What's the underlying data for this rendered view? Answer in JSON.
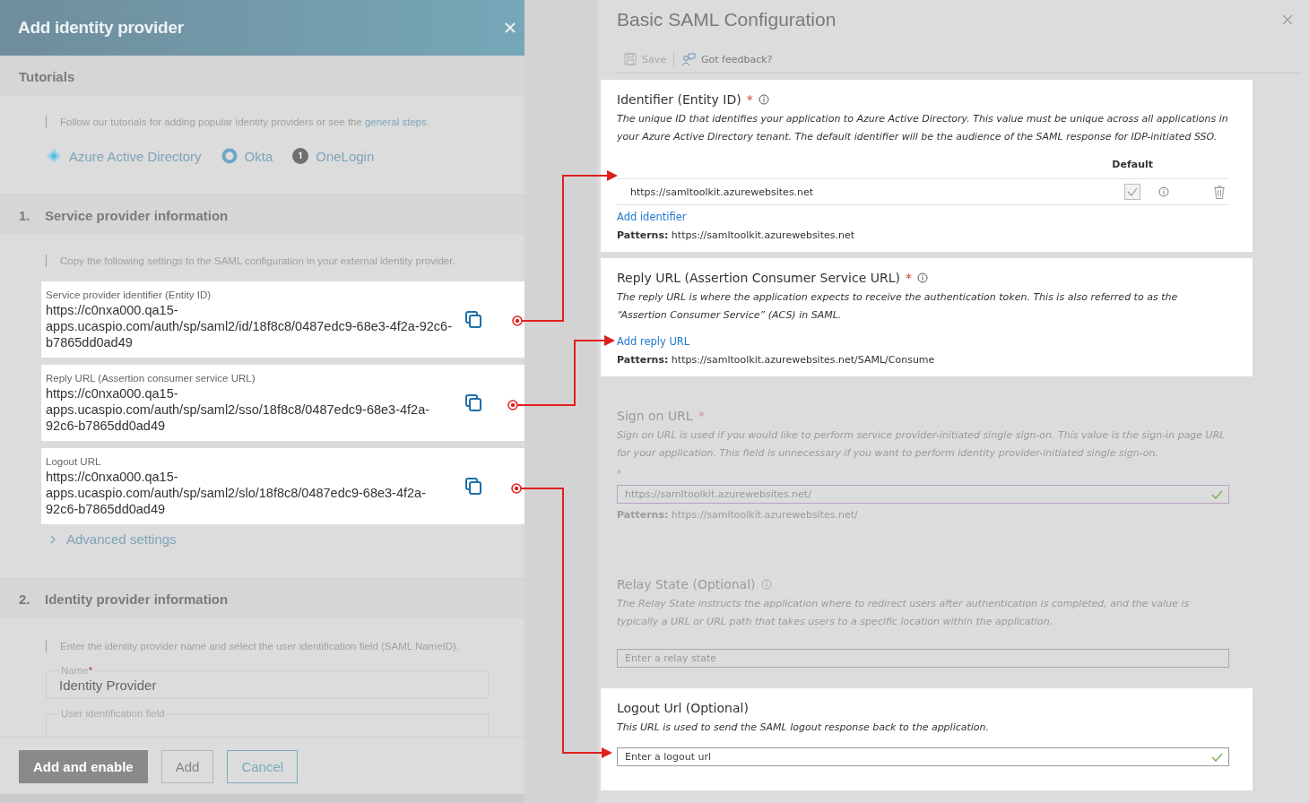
{
  "left_panel": {
    "title": "Add identity provider",
    "tutorials": {
      "heading": "Tutorials",
      "intro": "Follow our tutorials for adding popular identity providers or see the",
      "intro_link": "general steps",
      "intro_end": ".",
      "links": [
        {
          "label": "Azure Active Directory",
          "kind": "azure"
        },
        {
          "label": "Okta",
          "kind": "okta"
        },
        {
          "label": "OneLogin",
          "kind": "onelogin"
        }
      ]
    },
    "sections": [
      {
        "number": "1.",
        "title": "Service provider information",
        "description": "Copy the following settings to the SAML configuration in your external identity provider.",
        "fields": [
          {
            "label": "Service provider identifier (Entity ID)",
            "value": "https://c0nxa000.qa15-apps.ucaspio.com/auth/sp/saml2/id/18f8c8/0487edc9-68e3-4f2a-92c6-b7865dd0ad49"
          },
          {
            "label": "Reply URL (Assertion consumer service URL)",
            "value": "https://c0nxa000.qa15-apps.ucaspio.com/auth/sp/saml2/sso/18f8c8/0487edc9-68e3-4f2a-92c6-b7865dd0ad49"
          },
          {
            "label": "Logout URL",
            "value": "https://c0nxa000.qa15-apps.ucaspio.com/auth/sp/saml2/slo/18f8c8/0487edc9-68e3-4f2a-92c6-b7865dd0ad49"
          }
        ],
        "advanced": "Advanced settings"
      },
      {
        "number": "2.",
        "title": "Identity provider information",
        "description": "Enter the identity provider name and select the user identification field (SAML NameID).",
        "inputs": [
          {
            "label": "Name",
            "required_mark": "*",
            "value": "Identity Provider"
          },
          {
            "label": "User identification field"
          }
        ]
      }
    ],
    "buttons": [
      {
        "label": "Add and enable",
        "kind": "primary",
        "disabled": true
      },
      {
        "label": "Add",
        "kind": "secondary",
        "disabled": true
      },
      {
        "label": "Cancel",
        "kind": "secondary",
        "disabled": false
      }
    ]
  },
  "right_panel": {
    "title": "Basic SAML Configuration",
    "toolbar": [
      {
        "label": "Save",
        "kind": "save",
        "disabled": true
      },
      {
        "label": "Got feedback?",
        "kind": "feedback",
        "disabled": false
      }
    ],
    "sections": [
      {
        "kind": "identifier",
        "highlighted": true,
        "title": "Identifier (Entity ID)",
        "required_mark": "*",
        "info": true,
        "description": "The unique ID that identifies your application to Azure Active Directory. This value must be unique across all applications in your Azure Active Directory tenant. The default identifier will be the audience of the SAML response for IDP-initiated SSO.",
        "column_header": "Default",
        "rows": [
          {
            "value": "https://samltoolkit.azurewebsites.net",
            "default": true
          }
        ],
        "add_link": "Add identifier",
        "patterns_label": "Patterns:",
        "patterns": "https://samltoolkit.azurewebsites.net"
      },
      {
        "kind": "reply",
        "highlighted": true,
        "title": "Reply URL (Assertion Consumer Service URL)",
        "required_mark": "*",
        "info": true,
        "description": "The reply URL is where the application expects to receive the authentication token. This is also referred to as the “Assertion Consumer Service” (ACS) in SAML.",
        "add_link": "Add reply URL",
        "patterns_label": "Patterns:",
        "patterns": "https://samltoolkit.azurewebsites.net/SAML/Consume"
      },
      {
        "kind": "signon",
        "highlighted": false,
        "title": "Sign on URL",
        "required_mark": "*",
        "info": false,
        "description": "Sign on URL is used if you would like to perform service provider-initiated single sign-on. This value is the sign-in page URL for your application. This field is unnecessary if you want to perform identity provider-initiated single sign-on.",
        "field_mark": "*",
        "field": {
          "value": "https://samltoolkit.azurewebsites.net/",
          "valid": true
        },
        "patterns_label": "Patterns:",
        "patterns": "https://samltoolkit.azurewebsites.net/"
      },
      {
        "kind": "relay",
        "highlighted": false,
        "title": "Relay State (Optional)",
        "info": true,
        "description": "The Relay State instructs the application where to redirect users after authentication is completed, and the value is typically a URL or URL path that takes users to a specific location within the application.",
        "field": {
          "placeholder": "Enter a relay state",
          "valid": false
        }
      },
      {
        "kind": "logout",
        "highlighted": true,
        "title": "Logout Url (Optional)",
        "info": false,
        "description": "This URL is used to send the SAML logout response back to the application.",
        "field": {
          "placeholder": "Enter a logout url",
          "valid": true
        }
      }
    ]
  }
}
